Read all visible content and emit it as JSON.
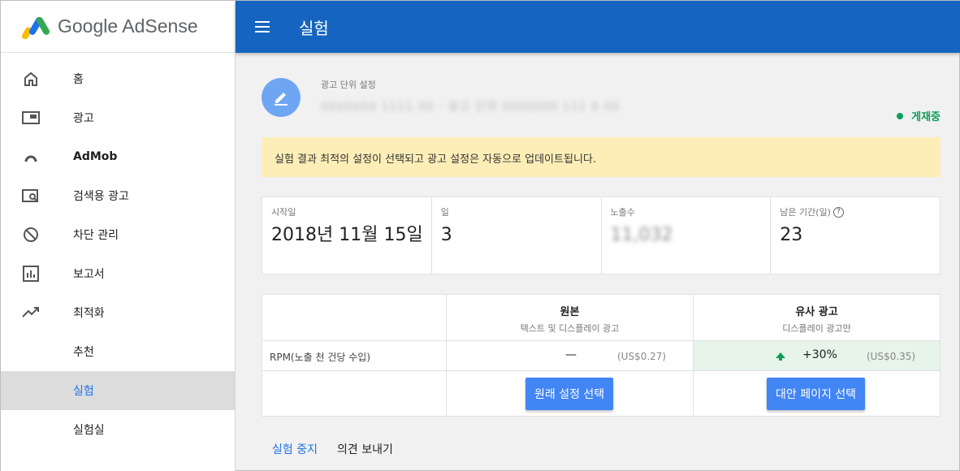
{
  "app": {
    "logo_text": "Google AdSense"
  },
  "sidebar": {
    "items": [
      {
        "label": "홈",
        "icon": "home-icon"
      },
      {
        "label": "광고",
        "icon": "ads-icon"
      },
      {
        "label": "AdMob",
        "icon": "admob-icon"
      },
      {
        "label": "검색용 광고",
        "icon": "search-ads-icon"
      },
      {
        "label": "차단 관리",
        "icon": "block-icon"
      },
      {
        "label": "보고서",
        "icon": "reports-icon"
      },
      {
        "label": "최적화",
        "icon": "trending-up-icon"
      },
      {
        "label": "추천",
        "icon": ""
      },
      {
        "label": "실험",
        "icon": "",
        "active": true
      },
      {
        "label": "실험실",
        "icon": ""
      }
    ]
  },
  "header": {
    "title": "실험"
  },
  "experiment": {
    "unit_label": "광고 단위 설정",
    "unit_name": "0000000 1111 00 - 광고 단위 0000000 111 0 00",
    "status": "게재중",
    "notice": "실험 결과 최적의 설정이 선택되고 광고 설정은 자동으로 업데이트됩니다."
  },
  "stats": [
    {
      "label": "시작일",
      "value": "2018년 11월 15일"
    },
    {
      "label": "일",
      "value": "3"
    },
    {
      "label": "노출수",
      "value": "11,032"
    },
    {
      "label": "남은 기간(일)",
      "value": "23"
    }
  ],
  "comparison": {
    "original": {
      "title": "원본",
      "subtitle": "텍스트 및 디스플레이 광고"
    },
    "variant": {
      "title": "유사 광고",
      "subtitle": "디스플레이 광고만"
    },
    "metric_label": "RPM(노출 천 건당 수입)",
    "original_change": "—",
    "original_value": "(US$0.27)",
    "variant_change": "+30%",
    "variant_value": "(US$0.35)",
    "original_button": "원래 설정 선택",
    "variant_button": "대안 페이지 선택"
  },
  "links": {
    "stop": "실험 중지",
    "feedback": "의견 보내기"
  },
  "colors": {
    "header": "#1565c0",
    "accent": "#4285f4",
    "status": "#0f9d58",
    "notice": "#fdeeb7"
  }
}
